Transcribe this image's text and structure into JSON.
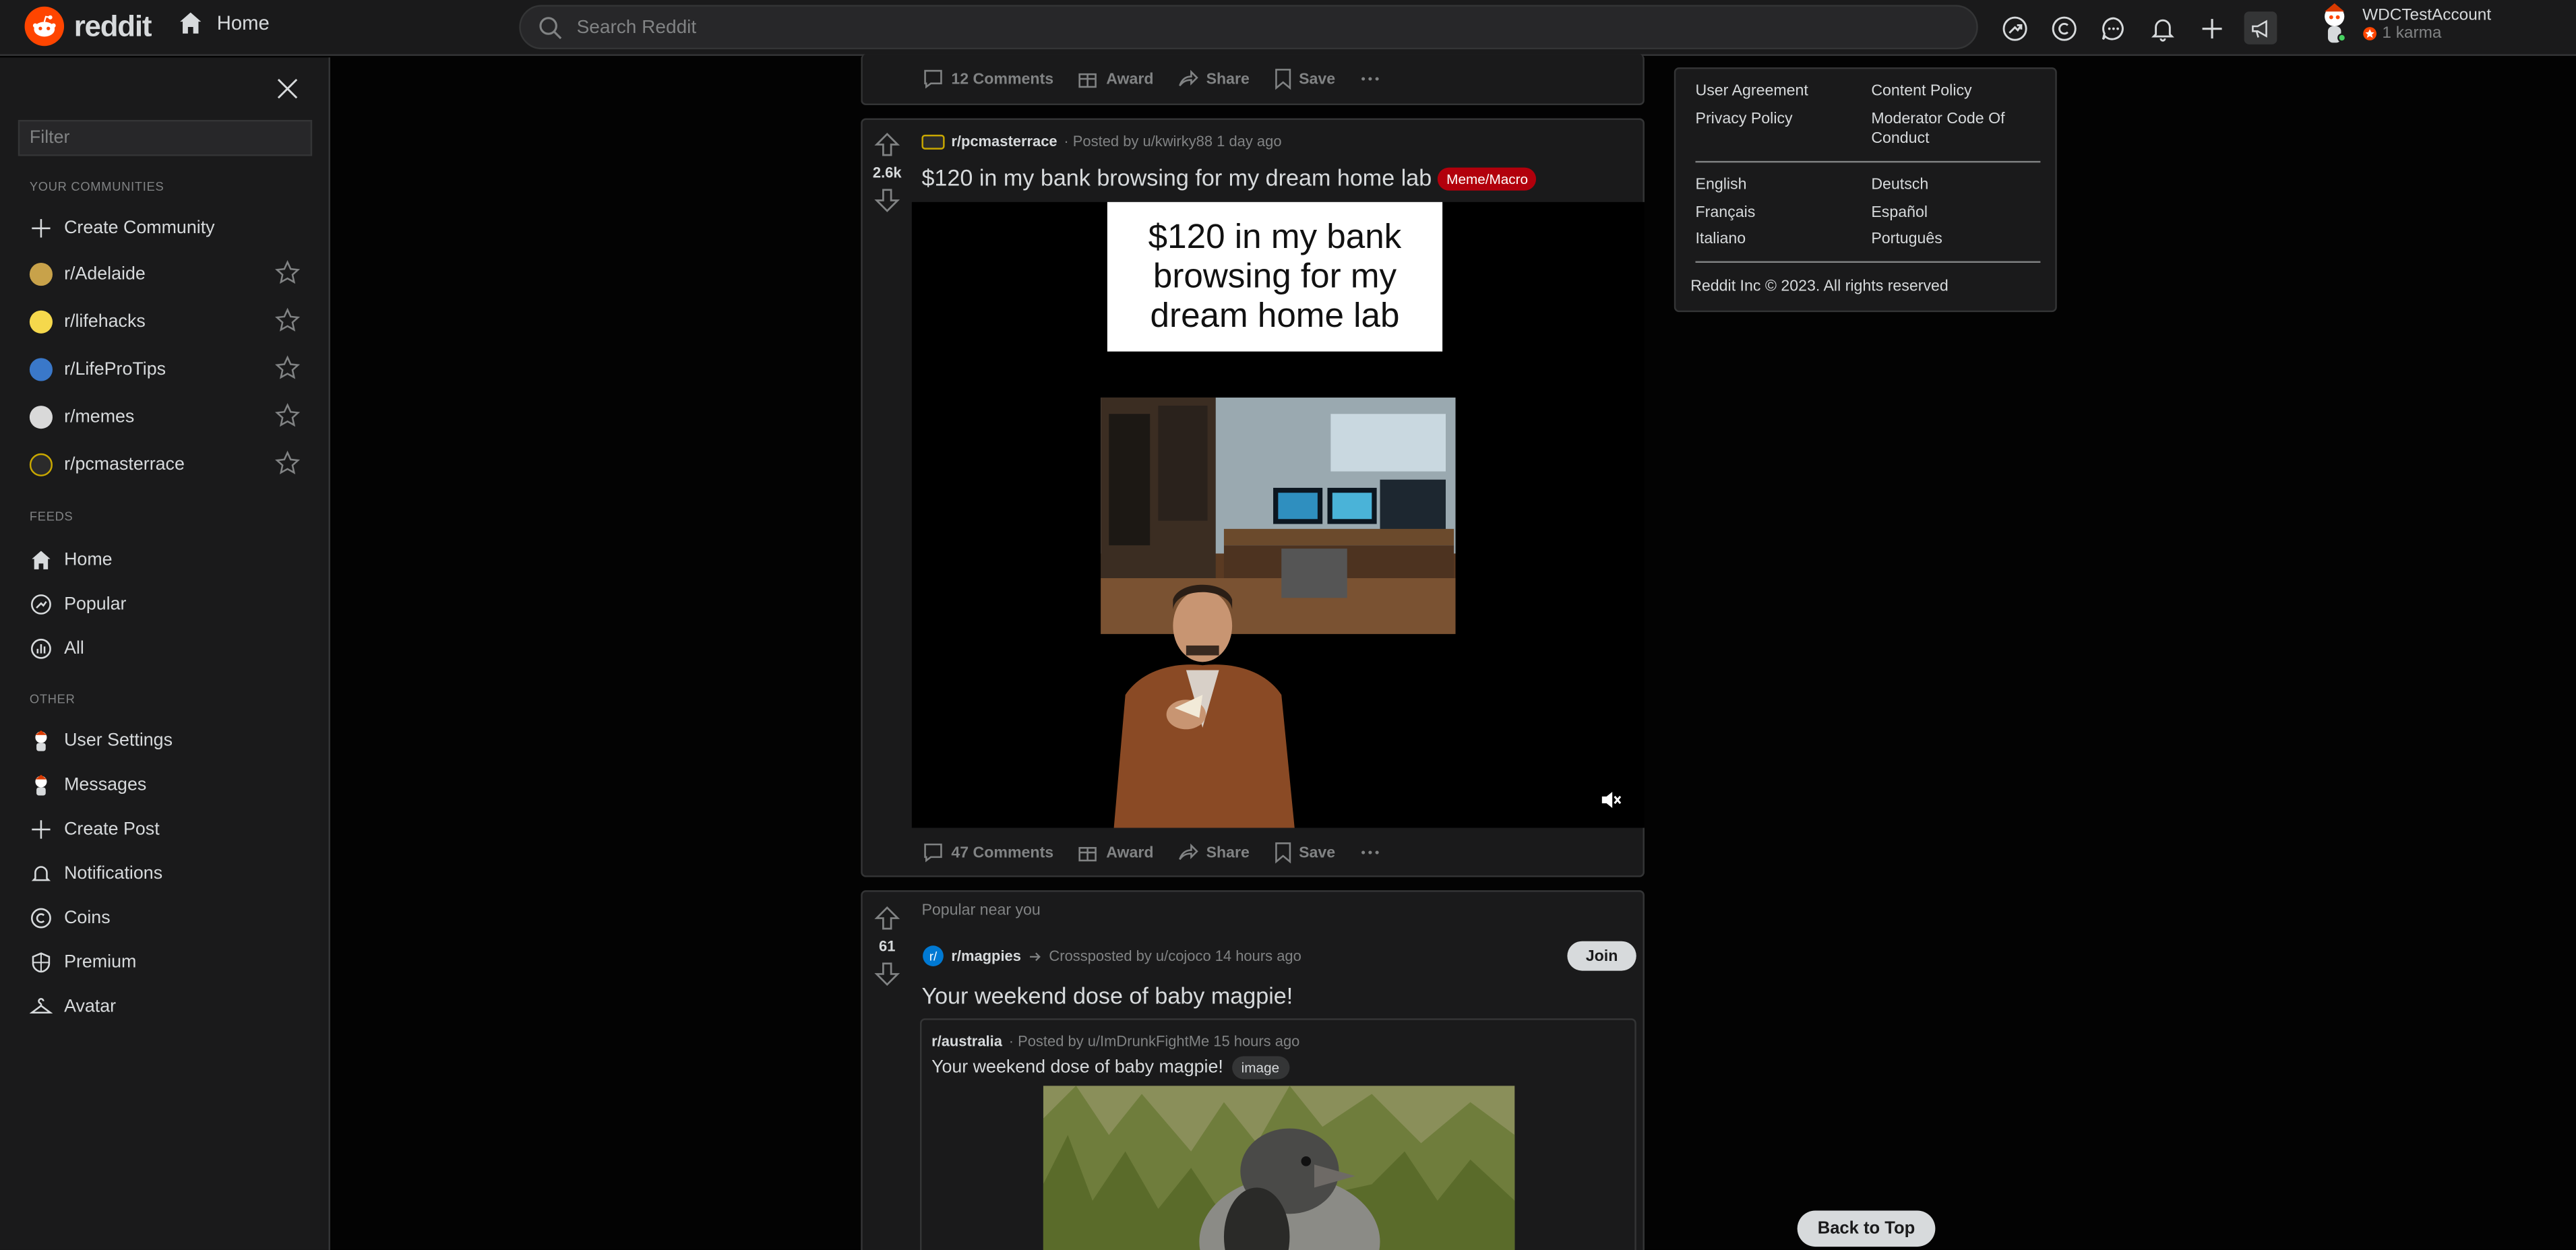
{
  "topbar": {
    "logo_text": "reddit",
    "home_label": "Home",
    "search_placeholder": "Search Reddit",
    "username": "WDCTestAccount",
    "karma": "1 karma"
  },
  "sidebar": {
    "filter_placeholder": "Filter",
    "communities_title": "YOUR COMMUNITIES",
    "create_community": "Create Community",
    "communities": [
      {
        "label": "r/Adelaide",
        "color": "#c8a24a"
      },
      {
        "label": "r/lifehacks",
        "color": "#f5d84c"
      },
      {
        "label": "r/LifeProTips",
        "color": "#3a78c9"
      },
      {
        "label": "r/memes",
        "color": "#d9d9d9"
      },
      {
        "label": "r/pcmasterrace",
        "color": "#2b2b2b"
      }
    ],
    "feeds_title": "FEEDS",
    "feeds": [
      "Home",
      "Popular",
      "All"
    ],
    "other_title": "OTHER",
    "other": [
      "User Settings",
      "Messages",
      "Create Post",
      "Notifications",
      "Coins",
      "Premium",
      "Avatar"
    ]
  },
  "top_actions": {
    "comments": "12 Comments",
    "award": "Award",
    "share": "Share",
    "save": "Save"
  },
  "post1": {
    "votes": "2.6k",
    "subreddit": "r/pcmasterrace",
    "posted_by": "· Posted by u/kwirky88 1 day ago",
    "title": "$120 in my bank browsing for my dream home lab",
    "flair": "Meme/Macro",
    "meme_text": "$120 in my bank browsing for my dream home lab",
    "comments": "47 Comments",
    "award": "Award",
    "share": "Share",
    "save": "Save"
  },
  "post2": {
    "popular_label": "Popular near you",
    "votes": "61",
    "subreddit": "r/magpies",
    "crosspost_text": "Crossposted by u/cojoco 14 hours ago",
    "join_label": "Join",
    "title": "Your weekend dose of baby magpie!",
    "inner_subreddit": "r/australia",
    "inner_posted_by": "· Posted by u/ImDrunkFightMe 15 hours ago",
    "inner_title": "Your weekend dose of baby magpie!",
    "inner_flair": "image"
  },
  "footer": {
    "links_left": [
      "User Agreement",
      "Privacy Policy"
    ],
    "links_right": [
      "Content Policy",
      "Moderator Code Of Conduct"
    ],
    "lang_left": [
      "English",
      "Français",
      "Italiano"
    ],
    "lang_right": [
      "Deutsch",
      "Español",
      "Português"
    ],
    "copyright": "Reddit Inc © 2023. All rights reserved"
  },
  "back_to_top": "Back to Top",
  "colors": {
    "brand": "#ff4500",
    "flair_red": "#b2000c",
    "background": "#030303",
    "surface": "#1a1a1b"
  }
}
